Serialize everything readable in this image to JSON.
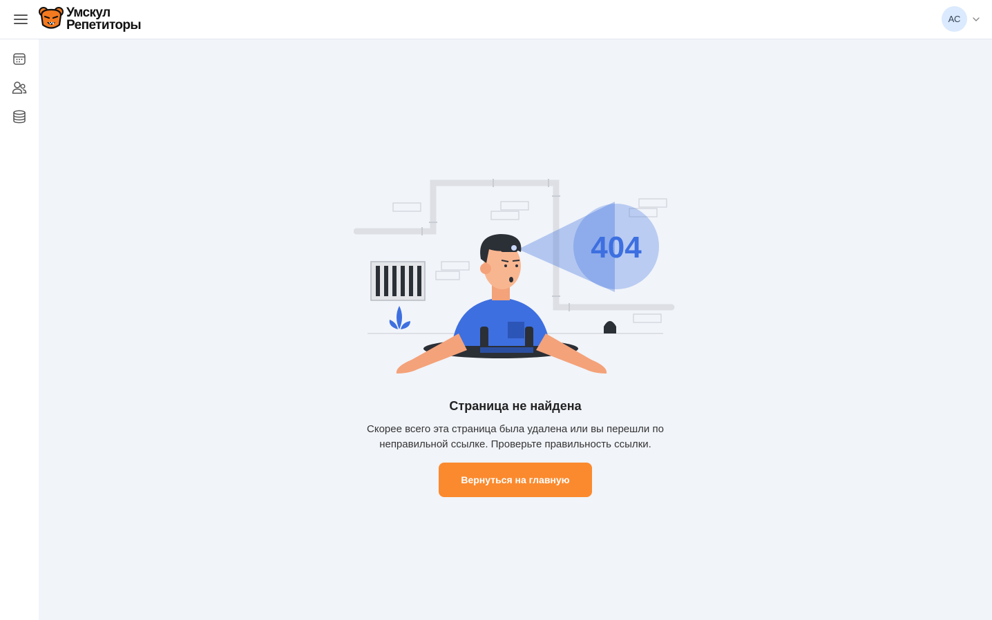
{
  "header": {
    "logo_line1": "Умскул",
    "logo_line2": "Репетиторы",
    "avatar_initials": "АС"
  },
  "sidebar": {
    "items": [
      {
        "icon": "calendar-icon"
      },
      {
        "icon": "users-icon"
      },
      {
        "icon": "database-icon"
      }
    ]
  },
  "error": {
    "code": "404",
    "title": "Страница не найдена",
    "description": "Скорее всего эта страница была удалена или вы перешли по неправильной ссылке. Проверьте правильность ссылки.",
    "button_label": "Вернуться на главную"
  },
  "colors": {
    "accent_orange": "#fb8a2e",
    "background": "#f1f4f9",
    "illustration_blue": "#3d6fe0",
    "avatar_bg": "#dbeafe"
  }
}
